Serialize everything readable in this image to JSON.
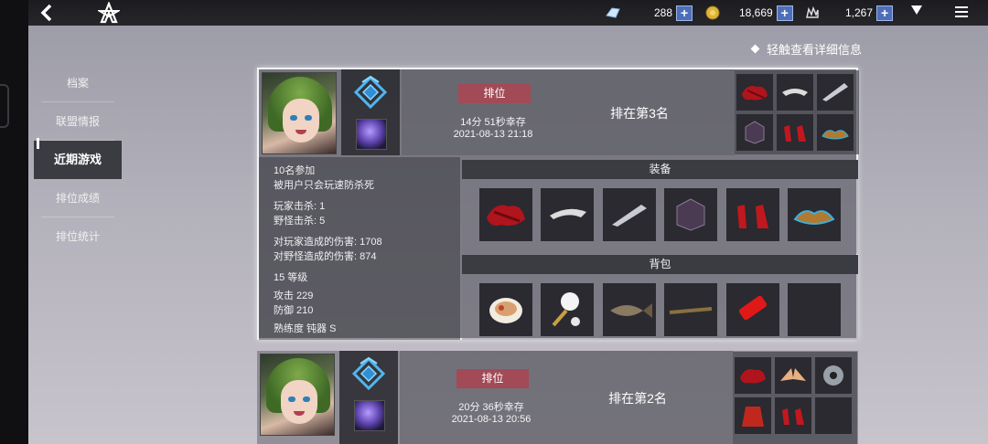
{
  "topbar": {
    "resources": [
      {
        "name": "crystal",
        "value": "288",
        "icon": "crystal-icon"
      },
      {
        "name": "gold",
        "value": "18,669",
        "icon": "coin-icon"
      },
      {
        "name": "material",
        "value": "1,267",
        "icon": "material-icon"
      }
    ]
  },
  "hint": "轻触查看详细信息",
  "sidebar": {
    "items": [
      {
        "label": "档案"
      },
      {
        "label": "联盟情报"
      },
      {
        "label": "近期游戏",
        "active": true
      },
      {
        "label": "排位成绩"
      },
      {
        "label": "排位统计"
      }
    ]
  },
  "matches": [
    {
      "mode": "排位",
      "survival": "14分 51秒幸存",
      "datetime": "2021-08-13 21:18",
      "rank": "排在第3名",
      "gear_icons": [
        "red-armor-icon",
        "silver-ring-icon",
        "blade-icon",
        "dark-armor-icon",
        "red-heels-icon",
        "bronze-boots-icon"
      ],
      "details": {
        "participants": "10名参加",
        "death": "被用户只会玩速防杀死",
        "player_kills": "玩家击杀: 1",
        "monster_kills": "野怪击杀: 5",
        "damage_players": "对玩家造成的伤害: 1708",
        "damage_monsters": "对野怪造成的伤害: 874",
        "level": "15 等级",
        "attack": "攻击 229",
        "defense": "防御 210",
        "mastery": "熟练度  钝器 S"
      },
      "equipment_title": "装备",
      "equipment": [
        "red-armor-icon",
        "silver-ring-icon",
        "blade-icon",
        "dark-armor-icon",
        "red-heels-icon",
        "bronze-boots-icon"
      ],
      "bag_title": "背包",
      "bag": [
        "bowl-food-icon",
        "chef-hat-icon",
        "fish-icon",
        "rod-icon",
        "lighter-icon",
        "empty-slot"
      ]
    },
    {
      "mode": "排位",
      "survival": "20分 36秒幸存",
      "datetime": "2021-08-13 20:56",
      "rank": "排在第2名",
      "gear_icons": [
        "red-armor-icon",
        "wings-icon",
        "disc-icon",
        "red-coat-icon",
        "red-heels-icon",
        "empty-slot"
      ]
    }
  ],
  "colors": {
    "mode_badge": "#a24a56",
    "plus_button": "#4e6fb8",
    "section_header": "#3b3b42"
  }
}
